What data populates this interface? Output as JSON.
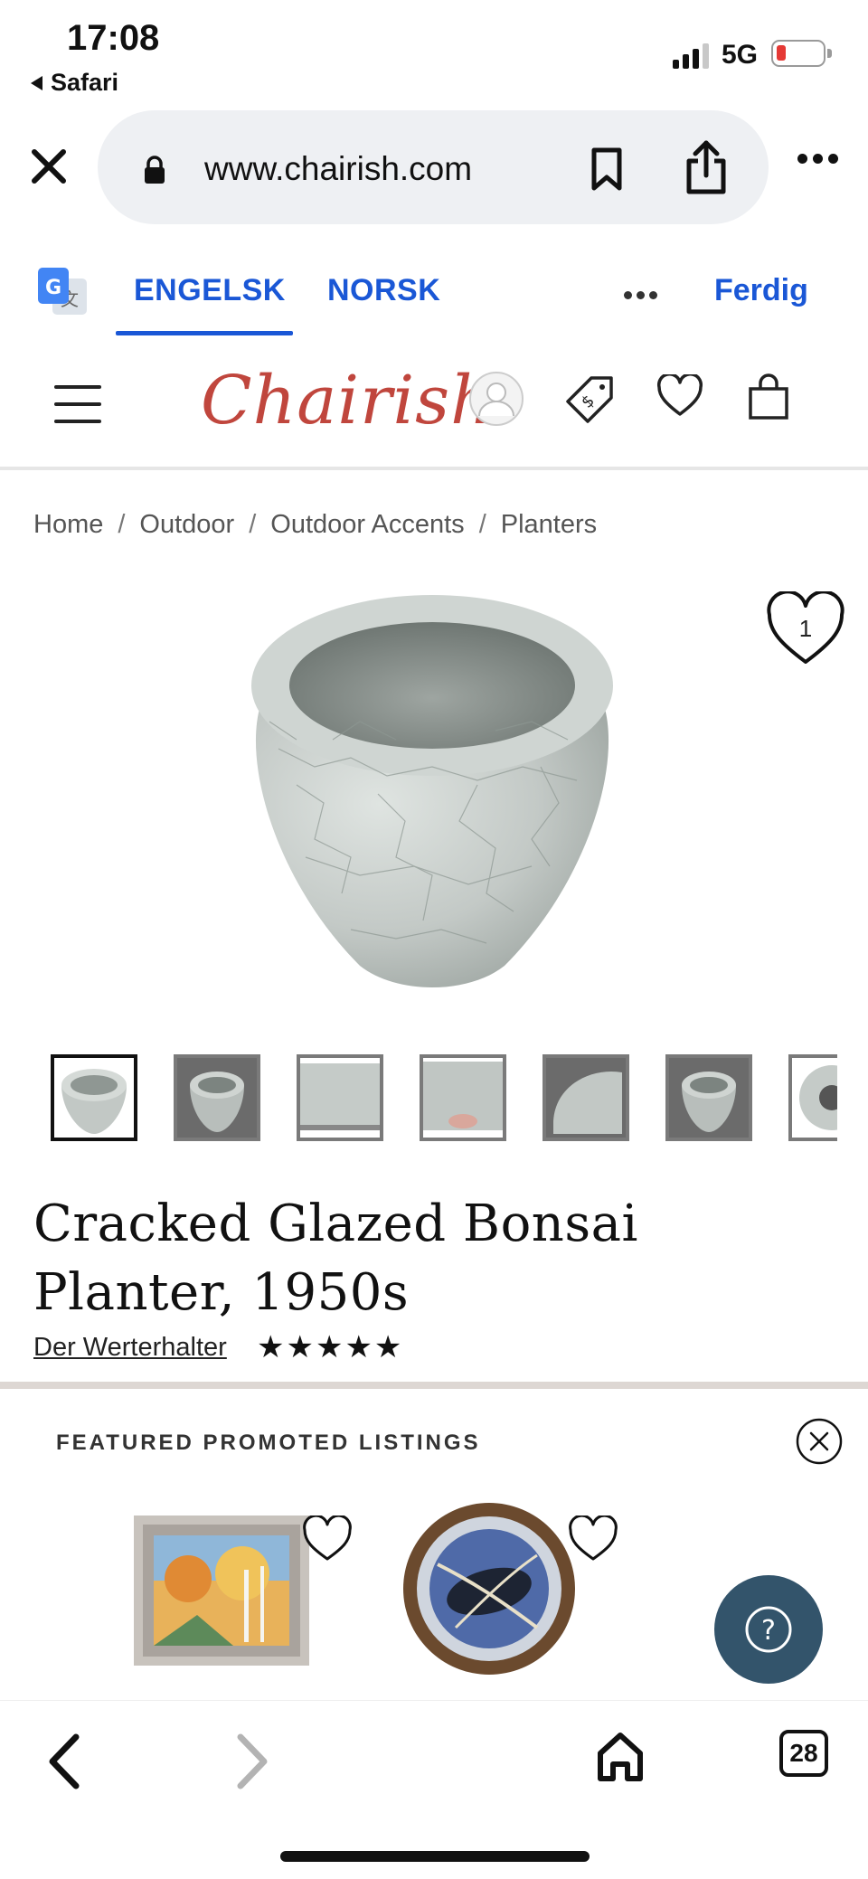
{
  "status_bar": {
    "time": "17:08",
    "back_app": "Safari",
    "network": "5G"
  },
  "browser": {
    "url": "www.chairish.com",
    "tab_count": "28"
  },
  "translate_bar": {
    "tabs": [
      "ENGELSK",
      "NORSK"
    ],
    "active_tab": "ENGELSK",
    "done_label": "Ferdig"
  },
  "site": {
    "logo": "Chairish",
    "brand_color": "#c0463d",
    "breadcrumb": [
      "Home",
      "Outdoor",
      "Outdoor Accents",
      "Planters"
    ],
    "favorite_count": "1"
  },
  "product": {
    "title": "Cracked Glazed Bonsai Planter, 1950s",
    "seller": "Der Werterhalter",
    "rating": 5,
    "rating_stars": "★★★★★",
    "thumbnails_visible": 7
  },
  "promoted": {
    "label": "FEATURED PROMOTED LISTINGS",
    "help_button_color": "#33546b"
  }
}
